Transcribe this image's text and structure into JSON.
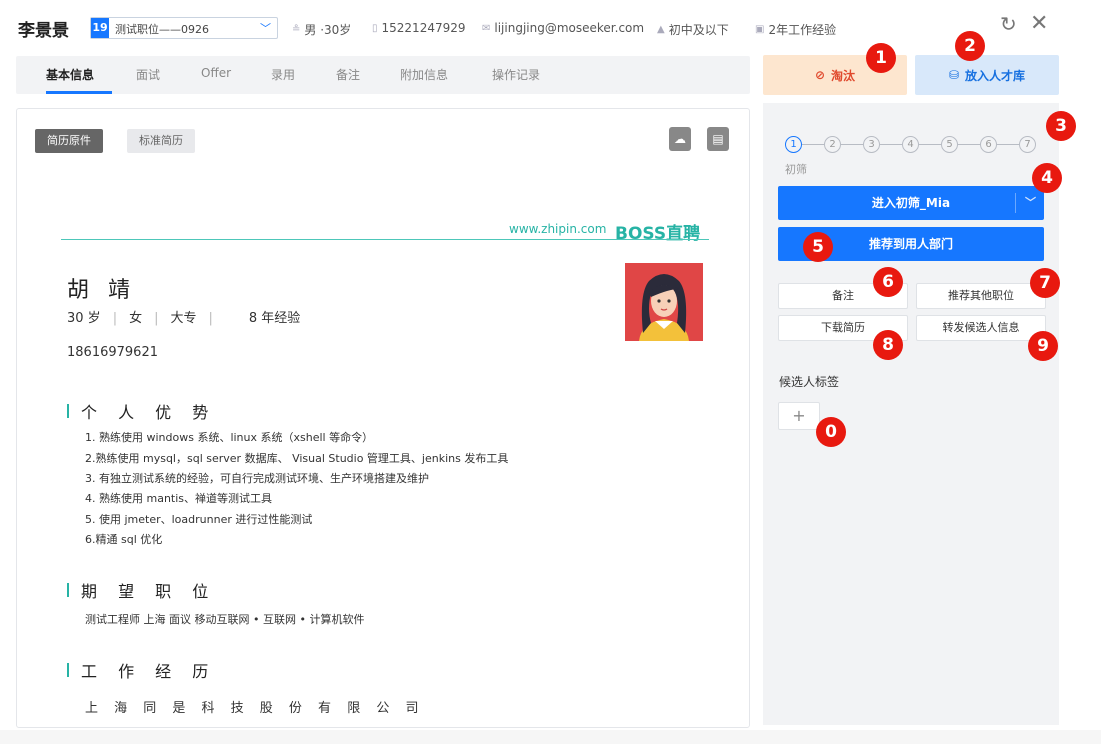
{
  "header": {
    "candidate_name": "李景景",
    "job_number": "19",
    "job_title": "测试职位——0926",
    "gender_age": "男 ·30岁",
    "phone": "15221247929",
    "email": "lijingjing@moseeker.com",
    "education": "初中及以下",
    "experience": "2年工作经验"
  },
  "tabs": [
    "基本信息",
    "面试",
    "Offer",
    "录用",
    "备注",
    "附加信息",
    "操作记录"
  ],
  "actions": {
    "reject_label": "淘汰",
    "pool_label": "放入人才库"
  },
  "resume": {
    "tab_original": "简历原件",
    "tab_standard": "标准简历",
    "source_url": "www.zhipin.com",
    "source_brand": "BOSS直聘",
    "name": "胡 靖",
    "age": "30 岁",
    "gender": "女",
    "degree": "大专",
    "years": "8 年经验",
    "phone": "18616979621",
    "advantages_title": "个 人 优 势",
    "advantages": [
      "1. 熟练使用 windows 系统、linux 系统（xshell 等命令）",
      "2.熟练使用 mysql，sql server 数据库、 Visual Studio 管理工具、jenkins 发布工具",
      "3. 有独立测试系统的经验，可自行完成测试环境、生产环境搭建及维护",
      "4. 熟练使用 mantis、禅道等测试工具",
      "5. 使用 jmeter、loadrunner 进行过性能测试",
      "6.精通 sql 优化"
    ],
    "expect_title": "期 望 职 位",
    "expect_line": "测试工程师   上海   面议   移动互联网 • 互联网 • 计算机软件",
    "work_title": "工 作 经 历",
    "company": "上 海 同 是 科 技 股 份 有 限 公 司"
  },
  "pipeline": {
    "steps": [
      "1",
      "2",
      "3",
      "4",
      "5",
      "6",
      "7"
    ],
    "current_stage": "初筛",
    "enter_label": "进入初筛_Mia",
    "recommend_label": "推荐到用人部门",
    "note_label": "备注",
    "other_job_label": "推荐其他职位",
    "download_label": "下载简历",
    "forward_label": "转发候选人信息",
    "tags_title": "候选人标签",
    "add_tag_label": "+"
  },
  "annotations": [
    "1",
    "2",
    "3",
    "4",
    "5",
    "6",
    "7",
    "8",
    "9",
    "0"
  ],
  "colors": {
    "primary": "#1677ff",
    "reject_bg": "#fde6cf",
    "reject_text": "#e0492d",
    "pool_bg": "#d8e8fa",
    "boss_teal": "#27b3a5",
    "badge_red": "#e8190f"
  }
}
